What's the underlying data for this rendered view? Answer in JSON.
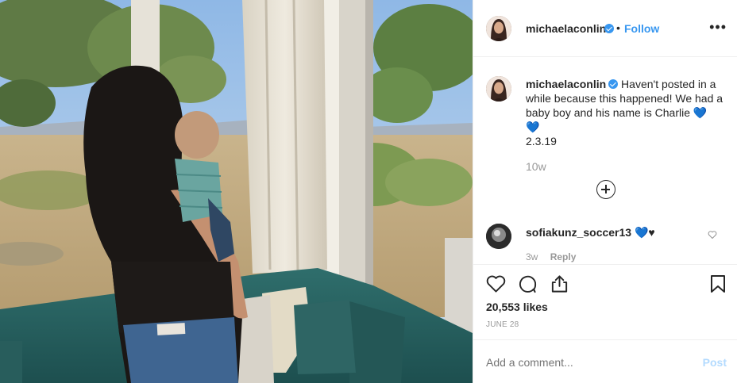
{
  "post": {
    "username": "michaelaconlin",
    "verified": true,
    "separator": "•",
    "follow_label": "Follow",
    "more_label": "•••",
    "caption_line1": "Haven't posted in a while because this happened! We had a baby boy and his name is Charlie 💙",
    "caption_rest": "💙\n2.3.19",
    "time_ago": "10w",
    "likes": "20,553 likes",
    "date": "JUNE 28"
  },
  "comments": [
    {
      "username": "sofiakunz_soccer13",
      "text": "💙♥",
      "time_ago": "3w",
      "reply_label": "Reply"
    }
  ],
  "add_comment": {
    "placeholder": "Add a comment...",
    "post_label": "Post"
  },
  "icons": {
    "header_avatar": "profile-avatar",
    "verified": "verified-badge-icon",
    "load_more": "plus-circle-icon",
    "like": "heart-icon",
    "comment": "speech-bubble-icon",
    "share": "share-icon",
    "save": "bookmark-icon"
  },
  "colors": {
    "link": "#3897f0",
    "muted": "#999999",
    "post_disabled": "#b3dbff"
  }
}
